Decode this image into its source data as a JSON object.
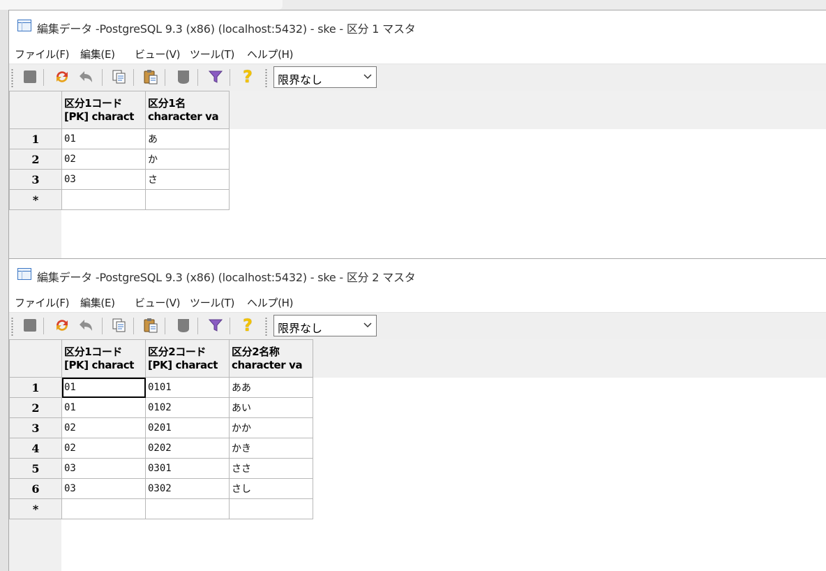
{
  "windows": [
    {
      "title": "編集データ -PostgreSQL 9.3 (x86) (localhost:5432) - ske - 区分 1 マスタ",
      "menu": [
        "ファイル(F)",
        "編集(E)",
        "ビュー(V)",
        "ツール(T)",
        "ヘルプ(H)"
      ],
      "limit_value": "限界なし",
      "columns": [
        {
          "name": "区分1コード",
          "type": "[PK] charact"
        },
        {
          "name": "区分1名",
          "type": "character va"
        }
      ],
      "rows": [
        {
          "num": "1",
          "cells": [
            "01",
            "あ"
          ]
        },
        {
          "num": "2",
          "cells": [
            "02",
            "か"
          ]
        },
        {
          "num": "3",
          "cells": [
            "03",
            "さ"
          ]
        },
        {
          "num": "*",
          "cells": [
            "",
            ""
          ]
        }
      ]
    },
    {
      "title": "編集データ -PostgreSQL 9.3 (x86) (localhost:5432) - ske - 区分 2 マスタ",
      "menu": [
        "ファイル(F)",
        "編集(E)",
        "ビュー(V)",
        "ツール(T)",
        "ヘルプ(H)"
      ],
      "limit_value": "限界なし",
      "columns": [
        {
          "name": "区分1コード",
          "type": "[PK] charact"
        },
        {
          "name": "区分2コード",
          "type": "[PK] charact"
        },
        {
          "name": "区分2名称",
          "type": "character va"
        }
      ],
      "rows": [
        {
          "num": "1",
          "cells": [
            "01",
            "0101",
            "ああ"
          ]
        },
        {
          "num": "2",
          "cells": [
            "01",
            "0102",
            "あい"
          ]
        },
        {
          "num": "3",
          "cells": [
            "02",
            "0201",
            "かか"
          ]
        },
        {
          "num": "4",
          "cells": [
            "02",
            "0202",
            "かき"
          ]
        },
        {
          "num": "5",
          "cells": [
            "03",
            "0301",
            "ささ"
          ]
        },
        {
          "num": "6",
          "cells": [
            "03",
            "0302",
            "さし"
          ]
        },
        {
          "num": "*",
          "cells": [
            "",
            "",
            ""
          ]
        }
      ]
    }
  ],
  "toolbar_icons": [
    "stop-icon",
    "refresh-icon",
    "undo-icon",
    "copy-icon",
    "paste-icon",
    "delete-icon",
    "filter-icon",
    "help-icon"
  ],
  "colors": {
    "refresh": "#d9412a",
    "filter": "#8a5cc2",
    "help": "#f2c200",
    "selection": "#000000"
  }
}
